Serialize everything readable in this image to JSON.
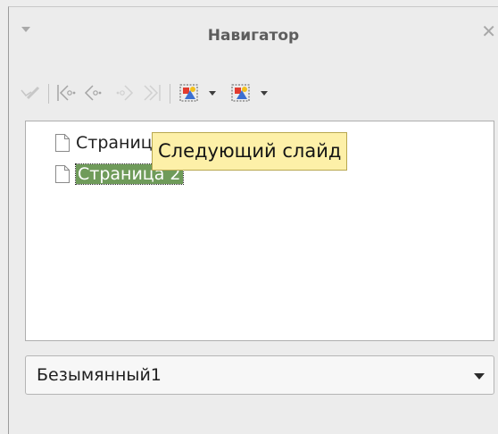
{
  "window": {
    "title": "Навигатор",
    "menu_icon": "triangle-down-icon",
    "close_icon": "close-icon",
    "close_glyph": "✕"
  },
  "toolbar": {
    "buttons": [
      {
        "name": "pen-button",
        "icon": "pen-icon",
        "enabled": false
      },
      {
        "name": "first-slide-button",
        "icon": "first-slide-icon",
        "enabled": true
      },
      {
        "name": "previous-slide-button",
        "icon": "previous-slide-icon",
        "enabled": true
      },
      {
        "name": "next-slide-button",
        "icon": "next-slide-icon",
        "enabled": false
      },
      {
        "name": "last-slide-button",
        "icon": "last-slide-icon",
        "enabled": false
      },
      {
        "name": "drag-mode-button",
        "icon": "drag-mode-icon",
        "has_dropdown": true
      },
      {
        "name": "show-shapes-button",
        "icon": "shapes-icon",
        "has_dropdown": true
      }
    ]
  },
  "tree": {
    "items": [
      {
        "label": "Страница 1",
        "selected": false,
        "icon": "page-icon"
      },
      {
        "label": "Страница 2",
        "selected": true,
        "icon": "page-icon"
      }
    ]
  },
  "tooltip": {
    "text": "Следующий слайд"
  },
  "document_select": {
    "value": "Безымянный1",
    "icon": "chevron-down-icon"
  },
  "colors": {
    "selection": "#6f9b5a",
    "tooltip_bg": "#fdf0a8",
    "panel_bg": "#ececec"
  }
}
